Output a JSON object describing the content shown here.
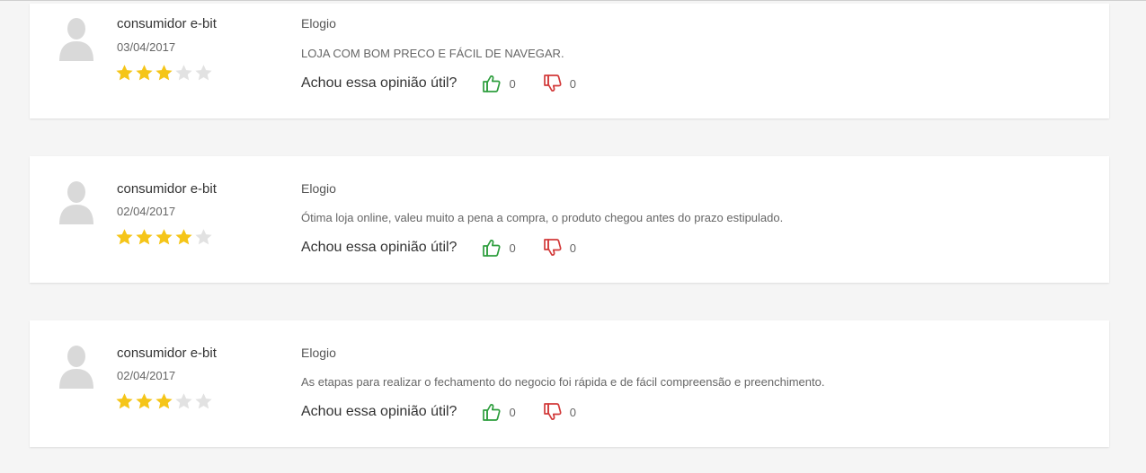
{
  "colors": {
    "star_filled": "#f5c518",
    "star_empty": "#e2e2e2",
    "thumbs_up": "#2e9e3e",
    "thumbs_down": "#d23a3a",
    "avatar": "#d9d9d9"
  },
  "reviews": [
    {
      "author": "consumidor e-bit",
      "date": "03/04/2017",
      "rating": 3,
      "category": "Elogio",
      "text": "LOJA COM BOM PRECO E FÁCIL DE NAVEGAR.",
      "useful_label": "Achou essa opinião útil?",
      "up_count": "0",
      "down_count": "0"
    },
    {
      "author": "consumidor e-bit",
      "date": "02/04/2017",
      "rating": 4,
      "category": "Elogio",
      "text": "Ótima loja online, valeu muito a pena a compra, o produto chegou antes do prazo estipulado.",
      "useful_label": "Achou essa opinião útil?",
      "up_count": "0",
      "down_count": "0"
    },
    {
      "author": "consumidor e-bit",
      "date": "02/04/2017",
      "rating": 3,
      "category": "Elogio",
      "text": "As etapas para realizar o fechamento do negocio foi rápida e de fácil compreensão e preenchimento.",
      "useful_label": "Achou essa opinião útil?",
      "up_count": "0",
      "down_count": "0"
    }
  ]
}
